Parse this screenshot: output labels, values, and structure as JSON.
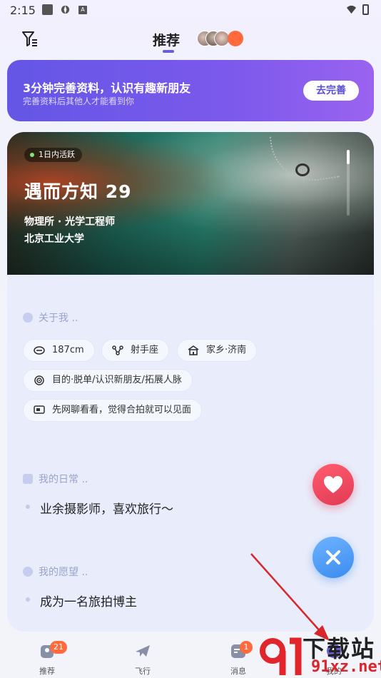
{
  "status_bar": {
    "time": "2:15"
  },
  "header": {
    "active_tab": "推荐"
  },
  "banner": {
    "title": "3分钟完善资料，认识有趣新朋友",
    "subtitle": "完善资料后其他人才能看到你",
    "button": "去完善"
  },
  "profile": {
    "active_badge": "1日内活跃",
    "name": "遇而方知 29",
    "job": "物理所 · 光学工程师",
    "school": "北京工业大学"
  },
  "about": {
    "title": "关于我 ..",
    "chips": [
      {
        "icon": "height-icon",
        "label": "187cm"
      },
      {
        "icon": "constellation-icon",
        "label": "射手座"
      },
      {
        "icon": "home-icon",
        "label": "家乡·济南"
      },
      {
        "icon": "target-icon",
        "label": "目的·脱单/认识新朋友/拓展人脉"
      },
      {
        "icon": "chat-icon",
        "label": "先网聊看看，觉得合拍就可以见面"
      }
    ]
  },
  "daily": {
    "title": "我的日常 ..",
    "text": "业余摄影师，喜欢旅行～"
  },
  "wish": {
    "title": "我的愿望 ..",
    "text": "成为一名旅拍博主"
  },
  "nav": {
    "items": [
      {
        "label": "推荐",
        "badge": "21"
      },
      {
        "label": "飞行",
        "badge": ""
      },
      {
        "label": "消息",
        "badge": "1"
      },
      {
        "label": "我的",
        "badge": ""
      }
    ]
  },
  "watermark": {
    "cn": "下载站",
    "en": "91xz.net"
  },
  "colors": {
    "accent": "#6b5fd6",
    "like": "#e23a55",
    "pass": "#3a8cf0",
    "badge": "#ff6b3d"
  }
}
